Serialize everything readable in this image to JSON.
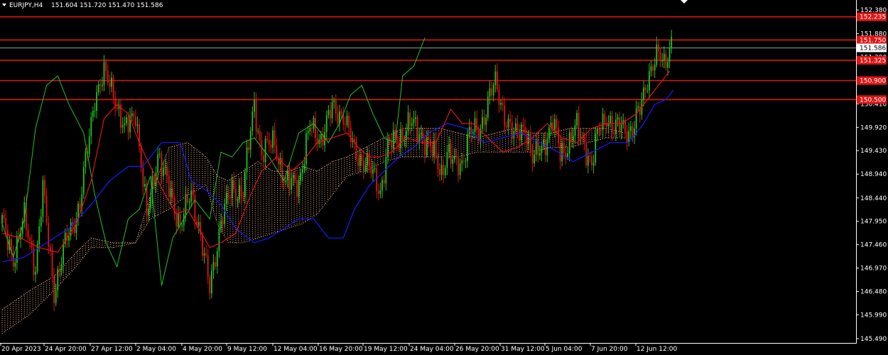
{
  "header": {
    "symbol": "EURJPY,H4",
    "ohlc": "151.604 151.720 151.470 151.586"
  },
  "colors": {
    "background": "#000000",
    "bull": "#22c222",
    "bear": "#e01414",
    "tenkan": "#e01414",
    "kijun": "#1a1aff",
    "chikou": "#22c222",
    "cloud": "#f2b48c",
    "level_line": "#e01414",
    "axis": "#ffffff"
  },
  "chart_data": {
    "type": "candlestick",
    "indicator": "Ichimoku",
    "symbol": "EURJPY",
    "timeframe": "H4",
    "ylim": [
      145.49,
      152.38
    ],
    "y_ticks": [
      "152.380",
      "151.880",
      "151.390",
      "150.900",
      "150.410",
      "149.920",
      "149.430",
      "148.940",
      "148.440",
      "147.950",
      "147.460",
      "146.970",
      "146.480",
      "145.990",
      "145.490"
    ],
    "x_ticks": [
      "20 Apr 2023",
      "24 Apr 20:00",
      "27 Apr 12:00",
      "2 May 04:00",
      "4 May 20:00",
      "9 May 12:00",
      "12 May 04:00",
      "16 May 20:00",
      "19 May 12:00",
      "24 May 04:00",
      "26 May 20:00",
      "31 May 12:00",
      "5 Jun 04:00",
      "7 Jun 20:00",
      "12 Jun 12:00"
    ],
    "current_price": "151.586",
    "levels": [
      {
        "value": 152.235,
        "label": "152.235"
      },
      {
        "value": 151.75,
        "label": "151.750"
      },
      {
        "value": 151.325,
        "label": "151.325"
      },
      {
        "value": 150.9,
        "label": "150.900"
      },
      {
        "value": 150.5,
        "label": "150.500"
      }
    ],
    "close_path": [
      [
        0,
        147.9
      ],
      [
        6,
        147.2
      ],
      [
        12,
        148.0
      ],
      [
        18,
        147.0
      ],
      [
        22,
        148.6
      ],
      [
        28,
        146.5
      ],
      [
        35,
        147.6
      ],
      [
        42,
        148.3
      ],
      [
        50,
        150.6
      ],
      [
        55,
        151.0
      ],
      [
        60,
        150.7
      ],
      [
        66,
        149.8
      ],
      [
        72,
        150.3
      ],
      [
        78,
        148.0
      ],
      [
        84,
        149.4
      ],
      [
        90,
        148.6
      ],
      [
        96,
        147.9
      ],
      [
        102,
        148.5
      ],
      [
        106,
        147.9
      ],
      [
        112,
        146.5
      ],
      [
        118,
        148.0
      ],
      [
        124,
        148.6
      ],
      [
        130,
        148.6
      ],
      [
        136,
        150.4
      ],
      [
        140,
        149.4
      ],
      [
        147,
        149.6
      ],
      [
        153,
        148.7
      ],
      [
        160,
        148.8
      ],
      [
        166,
        149.9
      ],
      [
        172,
        149.7
      ],
      [
        178,
        150.3
      ],
      [
        184,
        150.2
      ],
      [
        190,
        149.4
      ],
      [
        196,
        149.2
      ],
      [
        200,
        148.9
      ],
      [
        204,
        148.6
      ],
      [
        208,
        149.5
      ],
      [
        214,
        149.7
      ],
      [
        220,
        150.0
      ],
      [
        226,
        149.8
      ],
      [
        232,
        149.4
      ],
      [
        237,
        149.0
      ],
      [
        240,
        149.4
      ],
      [
        244,
        149.1
      ],
      [
        248,
        149.2
      ],
      [
        252,
        149.8
      ],
      [
        257,
        149.8
      ],
      [
        263,
        150.6
      ],
      [
        266,
        150.8
      ],
      [
        271,
        150.2
      ],
      [
        276,
        149.7
      ],
      [
        282,
        150.0
      ],
      [
        286,
        149.2
      ],
      [
        292,
        149.6
      ],
      [
        297,
        150.0
      ],
      [
        301,
        149.4
      ],
      [
        306,
        149.6
      ],
      [
        310,
        149.9
      ],
      [
        314,
        149.6
      ],
      [
        318,
        149.1
      ],
      [
        322,
        149.9
      ],
      [
        326,
        150.2
      ],
      [
        330,
        149.8
      ],
      [
        334,
        150.0
      ],
      [
        340,
        149.8
      ],
      [
        344,
        150.3
      ],
      [
        348,
        151.0
      ],
      [
        354,
        151.4
      ],
      [
        357,
        151.3
      ],
      [
        361,
        151.7
      ]
    ],
    "tenkan_path": [
      [
        0,
        147.7
      ],
      [
        10,
        147.6
      ],
      [
        20,
        147.4
      ],
      [
        30,
        147.3
      ],
      [
        40,
        147.9
      ],
      [
        48,
        148.8
      ],
      [
        55,
        150.1
      ],
      [
        62,
        150.4
      ],
      [
        68,
        150.2
      ],
      [
        75,
        149.5
      ],
      [
        80,
        149.1
      ],
      [
        88,
        148.5
      ],
      [
        94,
        148.1
      ],
      [
        100,
        148.2
      ],
      [
        106,
        147.8
      ],
      [
        112,
        147.4
      ],
      [
        118,
        147.5
      ],
      [
        126,
        147.7
      ],
      [
        134,
        148.5
      ],
      [
        140,
        149.0
      ],
      [
        148,
        149.3
      ],
      [
        156,
        149.0
      ],
      [
        162,
        149.2
      ],
      [
        170,
        149.6
      ],
      [
        178,
        149.7
      ],
      [
        186,
        149.8
      ],
      [
        192,
        149.5
      ],
      [
        198,
        149.3
      ],
      [
        204,
        149.3
      ],
      [
        210,
        149.4
      ],
      [
        218,
        149.7
      ],
      [
        226,
        149.6
      ],
      [
        234,
        149.6
      ],
      [
        242,
        150.3
      ],
      [
        248,
        150.0
      ],
      [
        254,
        150.0
      ],
      [
        262,
        149.7
      ],
      [
        270,
        149.4
      ],
      [
        278,
        149.5
      ],
      [
        286,
        149.7
      ],
      [
        294,
        150.0
      ],
      [
        302,
        149.7
      ],
      [
        310,
        149.6
      ],
      [
        318,
        149.9
      ],
      [
        326,
        150.0
      ],
      [
        334,
        150.0
      ],
      [
        342,
        150.2
      ],
      [
        350,
        150.6
      ],
      [
        356,
        150.9
      ],
      [
        360,
        151.1
      ]
    ],
    "kijun_path": [
      [
        0,
        147.1
      ],
      [
        12,
        147.2
      ],
      [
        24,
        147.5
      ],
      [
        36,
        147.8
      ],
      [
        48,
        148.3
      ],
      [
        58,
        148.8
      ],
      [
        68,
        149.1
      ],
      [
        76,
        149.1
      ],
      [
        86,
        149.6
      ],
      [
        96,
        149.6
      ],
      [
        102,
        148.8
      ],
      [
        110,
        148.6
      ],
      [
        118,
        148.3
      ],
      [
        126,
        147.8
      ],
      [
        136,
        147.5
      ],
      [
        144,
        147.6
      ],
      [
        152,
        147.8
      ],
      [
        160,
        148.0
      ],
      [
        168,
        148.0
      ],
      [
        176,
        147.6
      ],
      [
        184,
        147.6
      ],
      [
        190,
        148.2
      ],
      [
        198,
        148.7
      ],
      [
        206,
        149.0
      ],
      [
        214,
        149.3
      ],
      [
        222,
        149.5
      ],
      [
        230,
        149.8
      ],
      [
        240,
        150.0
      ],
      [
        250,
        149.9
      ],
      [
        260,
        149.6
      ],
      [
        270,
        149.7
      ],
      [
        280,
        149.8
      ],
      [
        290,
        149.6
      ],
      [
        300,
        149.4
      ],
      [
        308,
        149.2
      ],
      [
        318,
        149.4
      ],
      [
        328,
        149.6
      ],
      [
        338,
        149.6
      ],
      [
        346,
        150.0
      ],
      [
        352,
        150.4
      ],
      [
        358,
        150.5
      ],
      [
        362,
        150.7
      ]
    ],
    "chikou_path": [
      [
        0,
        147.9
      ],
      [
        6,
        147.2
      ],
      [
        12,
        148.0
      ],
      [
        18,
        149.9
      ],
      [
        24,
        150.8
      ],
      [
        30,
        151.0
      ],
      [
        36,
        150.4
      ],
      [
        44,
        149.8
      ],
      [
        50,
        148.5
      ],
      [
        56,
        147.5
      ],
      [
        62,
        147.0
      ],
      [
        68,
        148.0
      ],
      [
        74,
        148.2
      ],
      [
        80,
        148.9
      ],
      [
        86,
        146.6
      ],
      [
        92,
        147.6
      ],
      [
        98,
        148.0
      ],
      [
        104,
        148.4
      ],
      [
        112,
        148.0
      ],
      [
        118,
        149.4
      ],
      [
        124,
        149.3
      ],
      [
        130,
        149.6
      ],
      [
        136,
        149.7
      ],
      [
        144,
        149.3
      ],
      [
        152,
        148.8
      ],
      [
        160,
        149.8
      ],
      [
        168,
        150.0
      ],
      [
        176,
        149.6
      ],
      [
        182,
        150.0
      ],
      [
        188,
        150.6
      ],
      [
        194,
        150.8
      ],
      [
        200,
        150.2
      ],
      [
        206,
        149.7
      ],
      [
        212,
        149.6
      ],
      [
        216,
        151.0
      ],
      [
        222,
        151.2
      ],
      [
        228,
        151.8
      ]
    ],
    "cloud_a": [
      [
        0,
        146.1
      ],
      [
        15,
        146.5
      ],
      [
        28,
        146.8
      ],
      [
        40,
        147.3
      ],
      [
        48,
        147.6
      ],
      [
        60,
        147.5
      ],
      [
        72,
        147.5
      ],
      [
        80,
        148.5
      ],
      [
        90,
        149.5
      ],
      [
        100,
        149.6
      ],
      [
        110,
        149.3
      ],
      [
        116,
        148.9
      ],
      [
        122,
        148.8
      ],
      [
        130,
        149.0
      ],
      [
        138,
        149.2
      ],
      [
        146,
        149.0
      ],
      [
        154,
        149.0
      ],
      [
        162,
        149.1
      ],
      [
        170,
        149.0
      ],
      [
        178,
        149.2
      ],
      [
        186,
        149.3
      ],
      [
        196,
        149.5
      ],
      [
        206,
        149.7
      ],
      [
        216,
        149.9
      ],
      [
        226,
        149.9
      ],
      [
        236,
        149.9
      ],
      [
        246,
        149.8
      ],
      [
        256,
        149.7
      ],
      [
        266,
        149.8
      ],
      [
        276,
        149.9
      ],
      [
        286,
        149.8
      ],
      [
        296,
        149.8
      ],
      [
        306,
        149.9
      ],
      [
        316,
        149.9
      ],
      [
        326,
        149.9
      ],
      [
        336,
        149.8
      ]
    ],
    "cloud_b": [
      [
        0,
        145.6
      ],
      [
        15,
        146.0
      ],
      [
        28,
        146.5
      ],
      [
        40,
        147.0
      ],
      [
        48,
        147.4
      ],
      [
        60,
        147.4
      ],
      [
        72,
        147.5
      ],
      [
        80,
        148.0
      ],
      [
        90,
        148.2
      ],
      [
        100,
        148.5
      ],
      [
        110,
        148.7
      ],
      [
        116,
        147.9
      ],
      [
        122,
        147.5
      ],
      [
        130,
        147.5
      ],
      [
        138,
        147.6
      ],
      [
        146,
        147.7
      ],
      [
        154,
        147.8
      ],
      [
        162,
        147.9
      ],
      [
        170,
        148.1
      ],
      [
        178,
        148.5
      ],
      [
        186,
        148.9
      ],
      [
        196,
        149.0
      ],
      [
        206,
        149.2
      ],
      [
        216,
        149.3
      ],
      [
        226,
        149.3
      ],
      [
        236,
        149.3
      ],
      [
        246,
        149.3
      ],
      [
        256,
        149.4
      ],
      [
        266,
        149.4
      ],
      [
        276,
        149.4
      ],
      [
        286,
        149.4
      ],
      [
        296,
        149.5
      ],
      [
        306,
        149.5
      ],
      [
        316,
        149.6
      ],
      [
        326,
        149.7
      ],
      [
        336,
        149.7
      ]
    ]
  }
}
